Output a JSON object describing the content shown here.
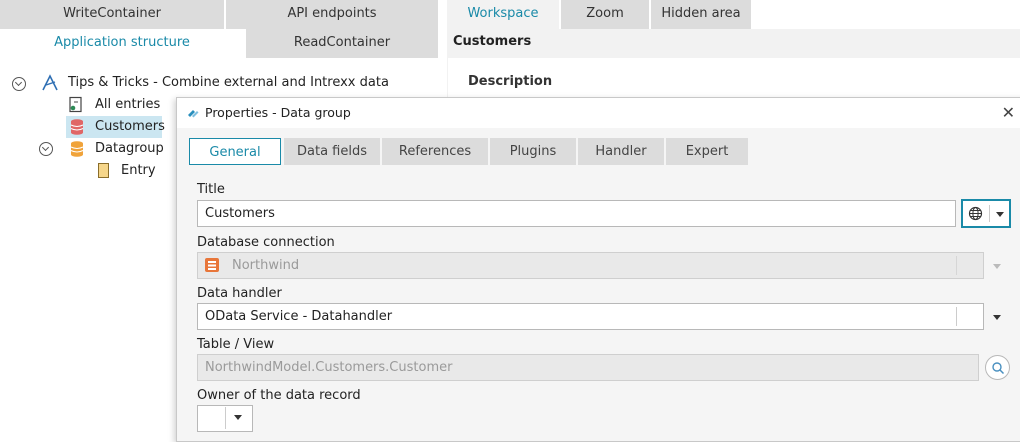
{
  "top_tabs_left": [
    {
      "label": "WriteContainer"
    },
    {
      "label": "API endpoints"
    },
    {
      "label": "Application structure"
    },
    {
      "label": "ReadContainer"
    }
  ],
  "top_tabs_right": [
    {
      "label": "Workspace"
    },
    {
      "label": "Zoom"
    },
    {
      "label": "Hidden area"
    }
  ],
  "tree": {
    "root": "Tips & Tricks - Combine external and Intrexx data",
    "items": [
      {
        "label": "All entries"
      },
      {
        "label": "Customers"
      },
      {
        "label": "Datagroup"
      },
      {
        "label": "Entry"
      }
    ]
  },
  "workspace": {
    "title": "Customers",
    "description_label": "Description"
  },
  "dialog": {
    "title": "Properties - Data group",
    "close": "✕",
    "tabs": [
      "General",
      "Data fields",
      "References",
      "Plugins",
      "Handler",
      "Expert"
    ],
    "title_label": "Title",
    "title_value": "Customers",
    "db_label": "Database connection",
    "db_value": "Northwind",
    "handler_label": "Data handler",
    "handler_value": "OData Service - Datahandler",
    "table_label": "Table / View",
    "table_value": "NorthwindModel.Customers.Customer",
    "owner_label": "Owner of the data record"
  },
  "colors": {
    "accent": "#1a8aa8",
    "tab_gray": "#dcdcdc"
  }
}
